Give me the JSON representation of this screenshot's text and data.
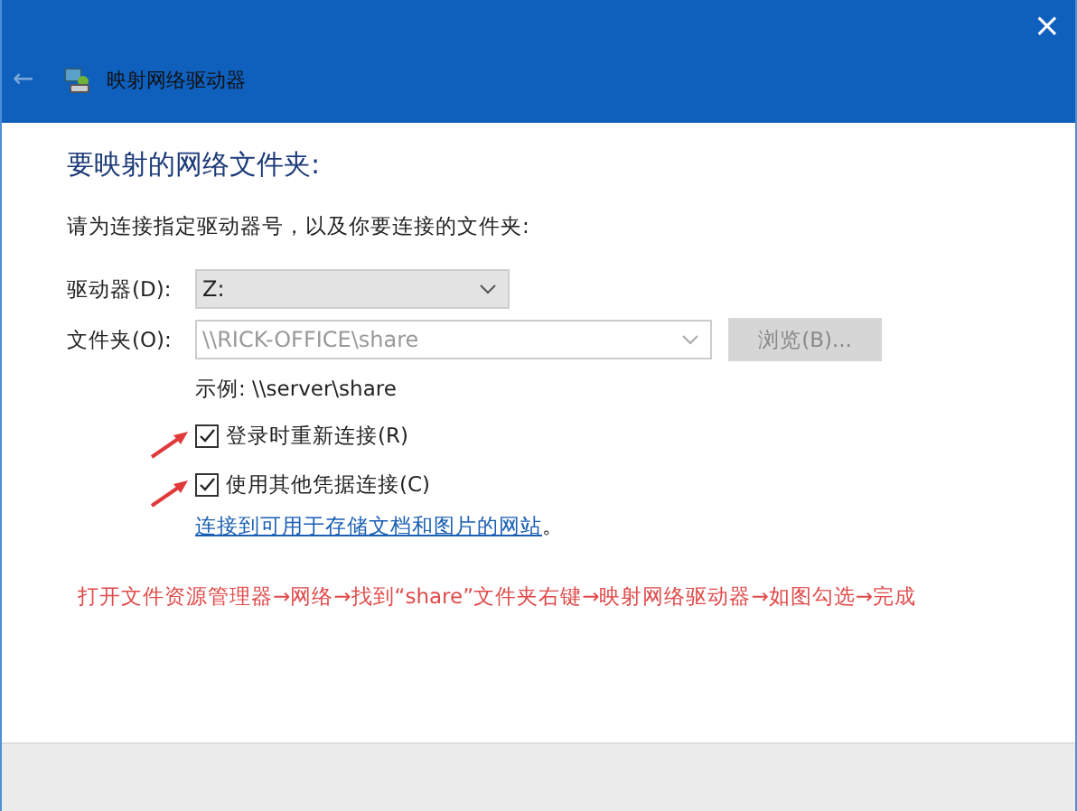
{
  "window": {
    "close": "×"
  },
  "header": {
    "back": "←",
    "title": "映射网络驱动器"
  },
  "heading": "要映射的网络文件夹:",
  "instruction": "请为连接指定驱动器号，以及你要连接的文件夹:",
  "drive": {
    "label": "驱动器(D):",
    "value": "Z:"
  },
  "folder": {
    "label": "文件夹(O):",
    "value": "\\\\RICK-OFFICE\\share",
    "disabled": true
  },
  "browse": {
    "label": "浏览(B)...",
    "disabled": true
  },
  "example": "示例: \\\\server\\share",
  "options": [
    {
      "label": "登录时重新连接(R)",
      "checked": true,
      "annotated": true
    },
    {
      "label": "使用其他凭据连接(C)",
      "checked": true,
      "annotated": true
    }
  ],
  "link": {
    "text": "连接到可用于存储文档和图片的网站",
    "suffix": "。"
  },
  "annotation": "打开文件资源管理器→网络→找到“share”文件夹右键→映射网络驱动器→如图勾选→完成"
}
